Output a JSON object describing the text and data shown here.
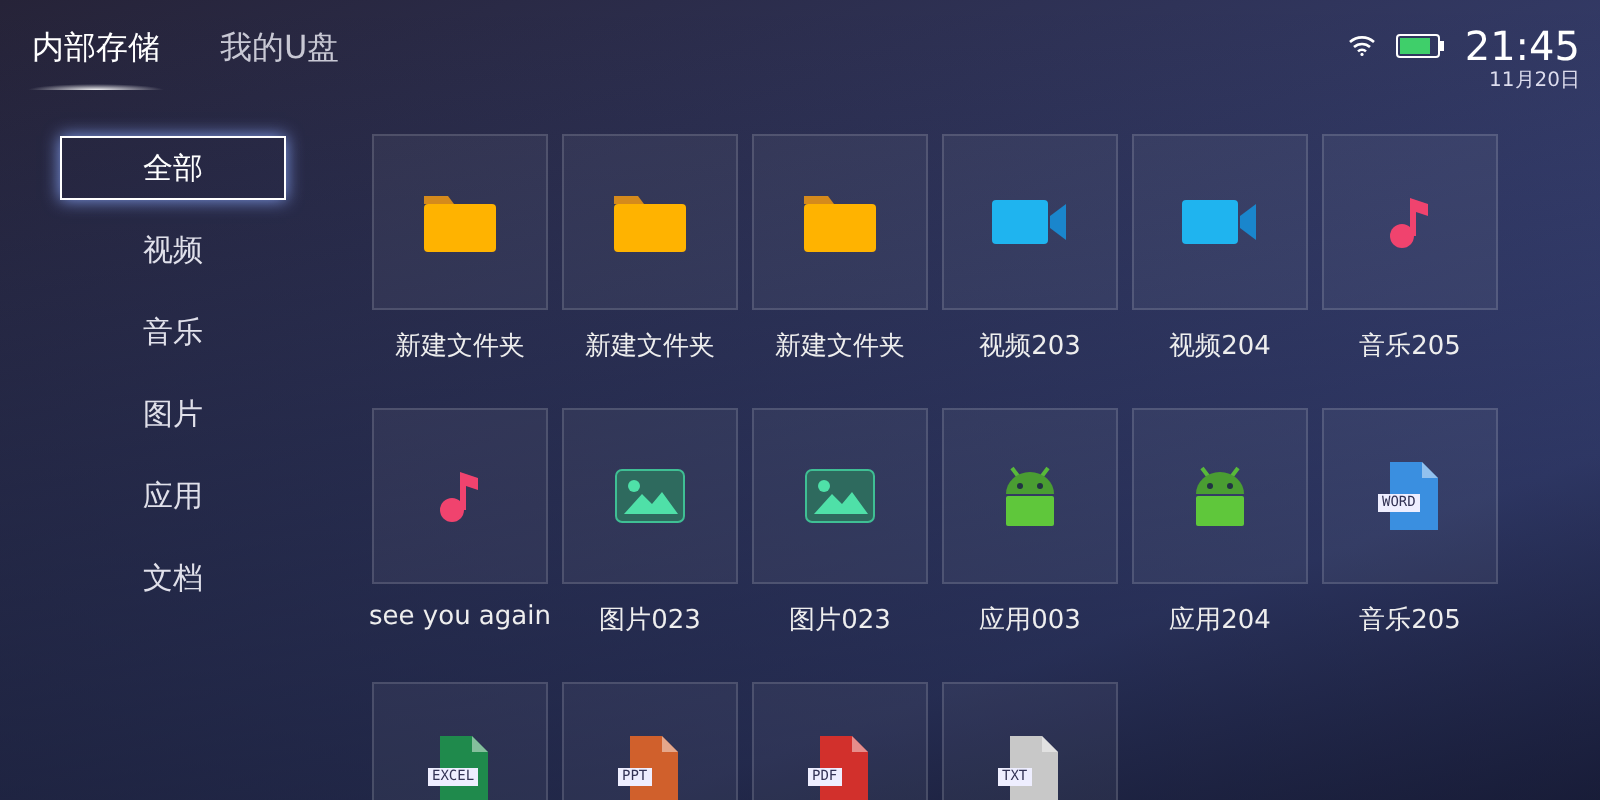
{
  "tabs": [
    {
      "label": "内部存储",
      "selected": true
    },
    {
      "label": "我的U盘",
      "selected": false
    }
  ],
  "status_bar": {
    "time": "21:45",
    "date": "11月20日"
  },
  "sidebar": {
    "items": [
      {
        "label": "全部",
        "selected": true
      },
      {
        "label": "视频",
        "selected": false
      },
      {
        "label": "音乐",
        "selected": false
      },
      {
        "label": "图片",
        "selected": false
      },
      {
        "label": "应用",
        "selected": false
      },
      {
        "label": "文档",
        "selected": false
      }
    ]
  },
  "files": [
    {
      "kind": "folder",
      "label": "新建文件夹"
    },
    {
      "kind": "folder",
      "label": "新建文件夹"
    },
    {
      "kind": "folder",
      "label": "新建文件夹"
    },
    {
      "kind": "video",
      "label": "视频203"
    },
    {
      "kind": "video",
      "label": "视频204"
    },
    {
      "kind": "music",
      "label": "音乐205"
    },
    {
      "kind": "music",
      "label": "see you again"
    },
    {
      "kind": "image",
      "label": "图片023"
    },
    {
      "kind": "image",
      "label": "图片023"
    },
    {
      "kind": "app",
      "label": "应用003"
    },
    {
      "kind": "app",
      "label": "应用204"
    },
    {
      "kind": "document",
      "label": "音乐205",
      "badge": "WORD",
      "color": "#3a8fe0"
    },
    {
      "kind": "document",
      "badge": "EXCEL",
      "color": "#1f8a4c"
    },
    {
      "kind": "document",
      "badge": "PPT",
      "color": "#d0602c"
    },
    {
      "kind": "document",
      "badge": "PDF",
      "color": "#d2302c"
    },
    {
      "kind": "document",
      "badge": "TXT",
      "color": "#c8c8c8"
    }
  ]
}
